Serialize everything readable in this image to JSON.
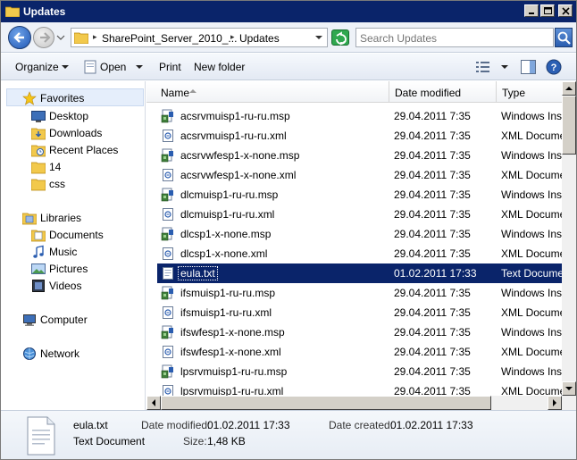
{
  "window": {
    "title": "Updates",
    "colors": {
      "title_bar": "#0a246a",
      "selection": "#0a246a"
    }
  },
  "address": {
    "segments": [
      "SharePoint_Server_2010_...",
      "Updates"
    ],
    "search_placeholder": "Search Updates"
  },
  "toolbar": {
    "organize": "Organize",
    "open": "Open",
    "print": "Print",
    "new_folder": "New folder"
  },
  "nav": {
    "favorites": "Favorites",
    "desktop": "Desktop",
    "downloads": "Downloads",
    "recent_places": "Recent Places",
    "folder_14": "14",
    "folder_css": "css",
    "libraries": "Libraries",
    "documents": "Documents",
    "music": "Music",
    "pictures": "Pictures",
    "videos": "Videos",
    "computer": "Computer",
    "network": "Network"
  },
  "columns": {
    "name": "Name",
    "date_modified": "Date modified",
    "type": "Type"
  },
  "files": [
    {
      "name": "acsrvmuisp1-ru-ru.msp",
      "date": "29.04.2011 7:35",
      "type": "Windows Installer Patch",
      "icon": "msp-icon"
    },
    {
      "name": "acsrvmuisp1-ru-ru.xml",
      "date": "29.04.2011 7:35",
      "type": "XML Document",
      "icon": "xml-icon"
    },
    {
      "name": "acsrvwfesp1-x-none.msp",
      "date": "29.04.2011 7:35",
      "type": "Windows Installer Patch",
      "icon": "msp-icon"
    },
    {
      "name": "acsrvwfesp1-x-none.xml",
      "date": "29.04.2011 7:35",
      "type": "XML Document",
      "icon": "xml-icon"
    },
    {
      "name": "dlcmuisp1-ru-ru.msp",
      "date": "29.04.2011 7:35",
      "type": "Windows Installer Patch",
      "icon": "msp-icon"
    },
    {
      "name": "dlcmuisp1-ru-ru.xml",
      "date": "29.04.2011 7:35",
      "type": "XML Document",
      "icon": "xml-icon"
    },
    {
      "name": "dlcsp1-x-none.msp",
      "date": "29.04.2011 7:35",
      "type": "Windows Installer Patch",
      "icon": "msp-icon"
    },
    {
      "name": "dlcsp1-x-none.xml",
      "date": "29.04.2011 7:35",
      "type": "XML Document",
      "icon": "xml-icon"
    },
    {
      "name": "eula.txt",
      "date": "01.02.2011 17:33",
      "type": "Text Document",
      "icon": "txt-icon",
      "selected": true
    },
    {
      "name": "ifsmuisp1-ru-ru.msp",
      "date": "29.04.2011 7:35",
      "type": "Windows Installer Patch",
      "icon": "msp-icon"
    },
    {
      "name": "ifsmuisp1-ru-ru.xml",
      "date": "29.04.2011 7:35",
      "type": "XML Document",
      "icon": "xml-icon"
    },
    {
      "name": "ifswfesp1-x-none.msp",
      "date": "29.04.2011 7:35",
      "type": "Windows Installer Patch",
      "icon": "msp-icon"
    },
    {
      "name": "ifswfesp1-x-none.xml",
      "date": "29.04.2011 7:35",
      "type": "XML Document",
      "icon": "xml-icon"
    },
    {
      "name": "lpsrvmuisp1-ru-ru.msp",
      "date": "29.04.2011 7:35",
      "type": "Windows Installer Patch",
      "icon": "msp-icon"
    },
    {
      "name": "lpsrvmuisp1-ru-ru.xml",
      "date": "29.04.2011 7:35",
      "type": "XML Document",
      "icon": "xml-icon"
    }
  ],
  "details": {
    "file_name": "eula.txt",
    "file_type": "Text Document",
    "date_modified_label": "Date modified:",
    "date_modified": "01.02.2011 17:33",
    "date_created_label": "Date created:",
    "date_created": "01.02.2011 17:33",
    "size_label": "Size:",
    "size": "1,48 KB"
  }
}
